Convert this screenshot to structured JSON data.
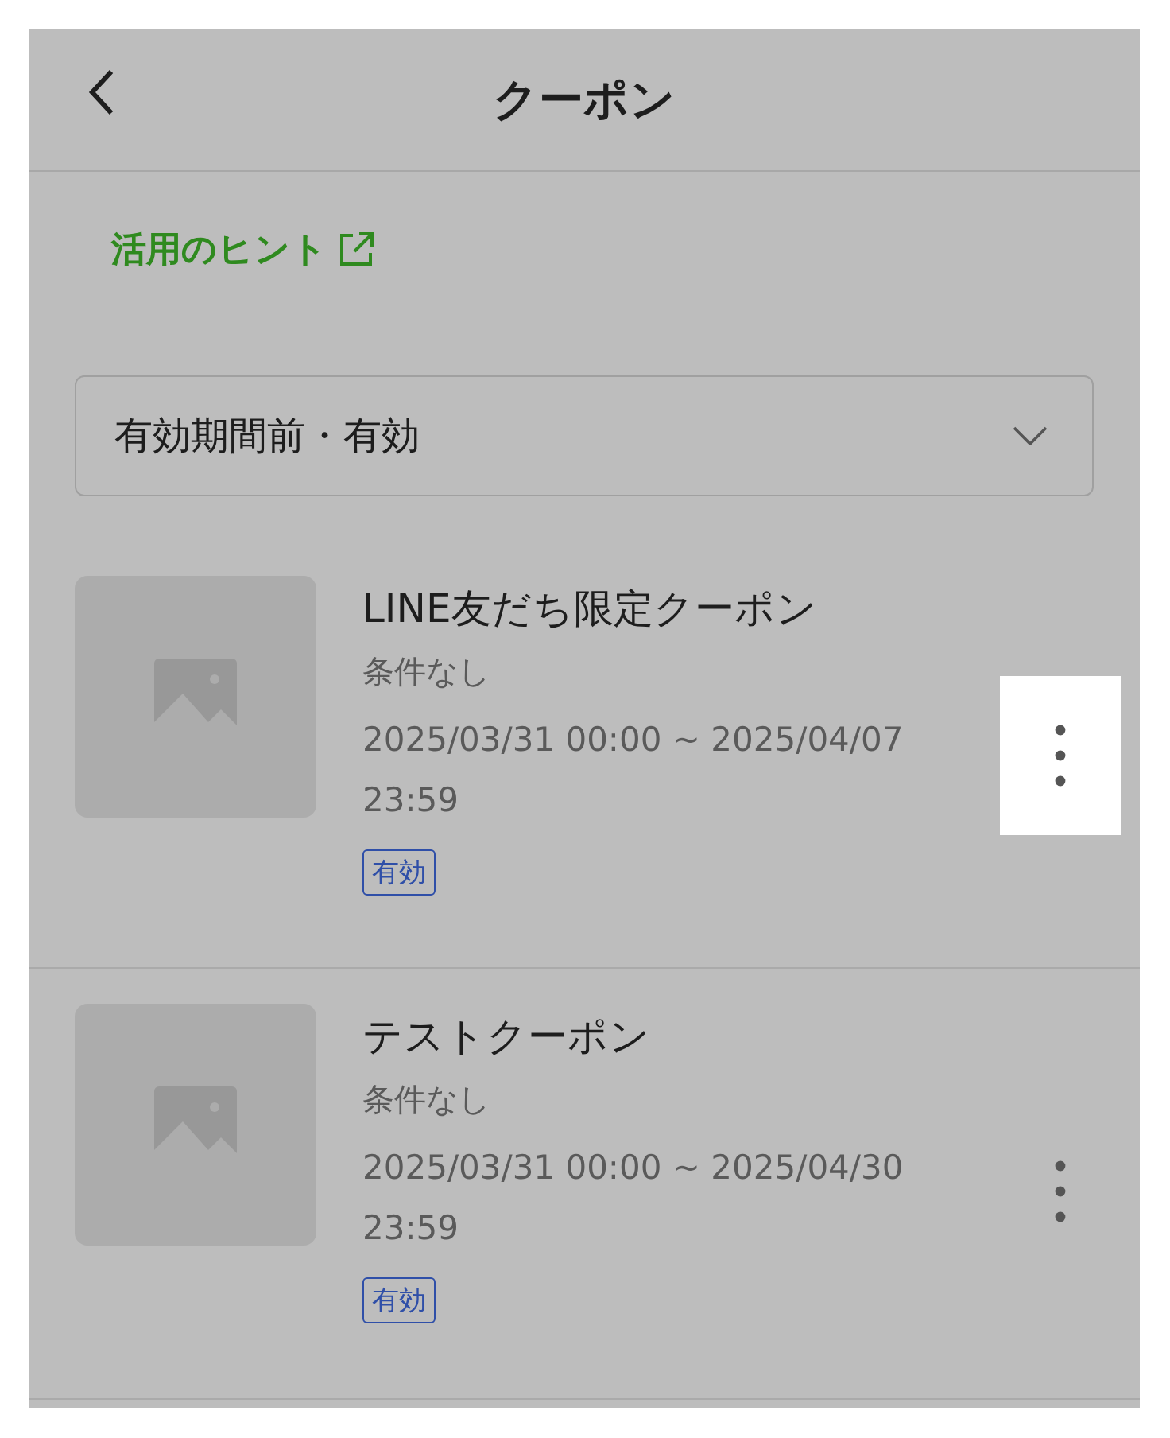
{
  "header": {
    "title": "クーポン"
  },
  "hint_link": {
    "label": "活用のヒント"
  },
  "filter": {
    "value": "有効期間前・有効"
  },
  "coupons": [
    {
      "kind": "picture",
      "title": "LINE友だち限定クーポン",
      "condition": "条件なし",
      "period": "2025/03/31 00:00 ~ 2025/04/07 23:59",
      "status": "有効",
      "menu_highlighted": true
    },
    {
      "kind": "picture",
      "title": "テストクーポン",
      "condition": "条件なし",
      "period": "2025/03/31 00:00 ~ 2025/04/30 23:59",
      "status": "有効",
      "menu_highlighted": false
    }
  ]
}
